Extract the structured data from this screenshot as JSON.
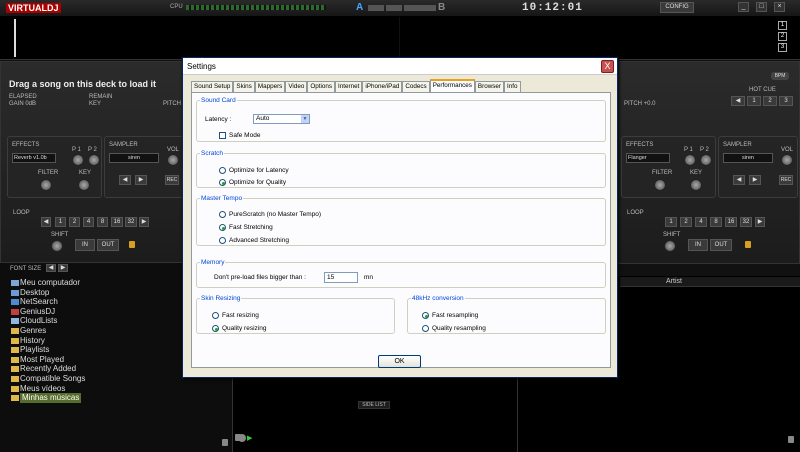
{
  "topbar": {
    "logo": "VIRTUALDJ",
    "cpu_label": "CPU",
    "a_label": "A",
    "b_label": "B",
    "clock": "10:12:01",
    "config_label": "CONFIG",
    "win_min": "_",
    "win_max": "□",
    "win_close": "×"
  },
  "deck_left": {
    "title": "Drag a song on this deck to load it",
    "elapsed": "ELAPSED",
    "remain": "REMAIN",
    "gain": "GAIN 0dB",
    "key": "KEY",
    "pitch": "PITCH",
    "effects_label": "EFFECTS",
    "effect_value": "Reverb v1.0b",
    "p1": "P 1",
    "p2": "P 2",
    "filter": "FILTER",
    "key_knob": "KEY",
    "sampler_label": "SAMPLER",
    "sampler_value": "siren",
    "vol": "VOL",
    "rec": "REC",
    "loop_label": "LOOP",
    "loop_sizes": [
      "1",
      "2",
      "4",
      "8",
      "16",
      "32"
    ],
    "shift": "SHIFT",
    "in": "IN",
    "out": "OUT"
  },
  "deck_right": {
    "bpm": "BPM",
    "pitch": "PITCH +0.0",
    "hotcue": "HOT CUE",
    "hotcues": [
      "1",
      "2",
      "3"
    ],
    "deck_nums": [
      "1",
      "2",
      "3"
    ],
    "effects_label": "EFFECTS",
    "effect_value": "Flanger",
    "p1": "P 1",
    "p2": "P 2",
    "filter": "FILTER",
    "key_knob": "KEY",
    "sampler_label": "SAMPLER",
    "sampler_value": "siren",
    "vol": "VOL",
    "rec": "REC",
    "loop_label": "LOOP",
    "loop_sizes": [
      "1",
      "2",
      "4",
      "8",
      "16",
      "32"
    ],
    "shift": "SHIFT",
    "in": "IN",
    "out": "OUT"
  },
  "browser": {
    "font_size_label": "FONT SIZE",
    "items": [
      {
        "label": "Meu computador",
        "icon": "computer-icon"
      },
      {
        "label": "Desktop",
        "icon": "desktop-icon"
      },
      {
        "label": "NetSearch",
        "icon": "globe-icon"
      },
      {
        "label": "GeniusDJ",
        "icon": "genius-icon"
      },
      {
        "label": "CloudLists",
        "icon": "cloud-icon"
      },
      {
        "label": "Genres",
        "icon": "folder-icon"
      },
      {
        "label": "History",
        "icon": "folder-icon"
      },
      {
        "label": "Playlists",
        "icon": "folder-icon"
      },
      {
        "label": "Most Played",
        "icon": "folder-icon"
      },
      {
        "label": "Recently Added",
        "icon": "folder-icon"
      },
      {
        "label": "Compatible Songs",
        "icon": "folder-icon"
      },
      {
        "label": "Meus vídeos",
        "icon": "folder-icon"
      },
      {
        "label": "Minhas músicas",
        "icon": "folder-icon"
      }
    ],
    "selected_index": 12,
    "column_artist": "Artist",
    "side_list": "SIDE LIST"
  },
  "dialog": {
    "title": "Settings",
    "close": "X",
    "tabs": [
      "Sound Setup",
      "Skins",
      "Mappers",
      "Video",
      "Options",
      "Internet",
      "iPhone/iPad",
      "Codecs",
      "Performances",
      "Browser",
      "Info"
    ],
    "active_tab": "Performances",
    "sound_card": {
      "legend": "Sound Card",
      "latency_label": "Latency :",
      "latency_value": "Auto",
      "safe_mode": "Safe Mode"
    },
    "scratch": {
      "legend": "Scratch",
      "opt1": "Optimize for Latency",
      "opt2": "Optimize for Quality"
    },
    "master_tempo": {
      "legend": "Master Tempo",
      "opt1": "PureScratch (no Master Tempo)",
      "opt2": "Fast Stretching",
      "opt3": "Advanced Stretching"
    },
    "memory": {
      "legend": "Memory",
      "label": "Don't pre-load files bigger than :",
      "value": "15",
      "unit": "mn"
    },
    "skin_resizing": {
      "legend": "Skin Resizing",
      "opt1": "Fast resizing",
      "opt2": "Quality resizing"
    },
    "conversion": {
      "legend": "48kHz conversion",
      "opt1": "Fast resampling",
      "opt2": "Quality resampling"
    },
    "ok": "OK"
  }
}
